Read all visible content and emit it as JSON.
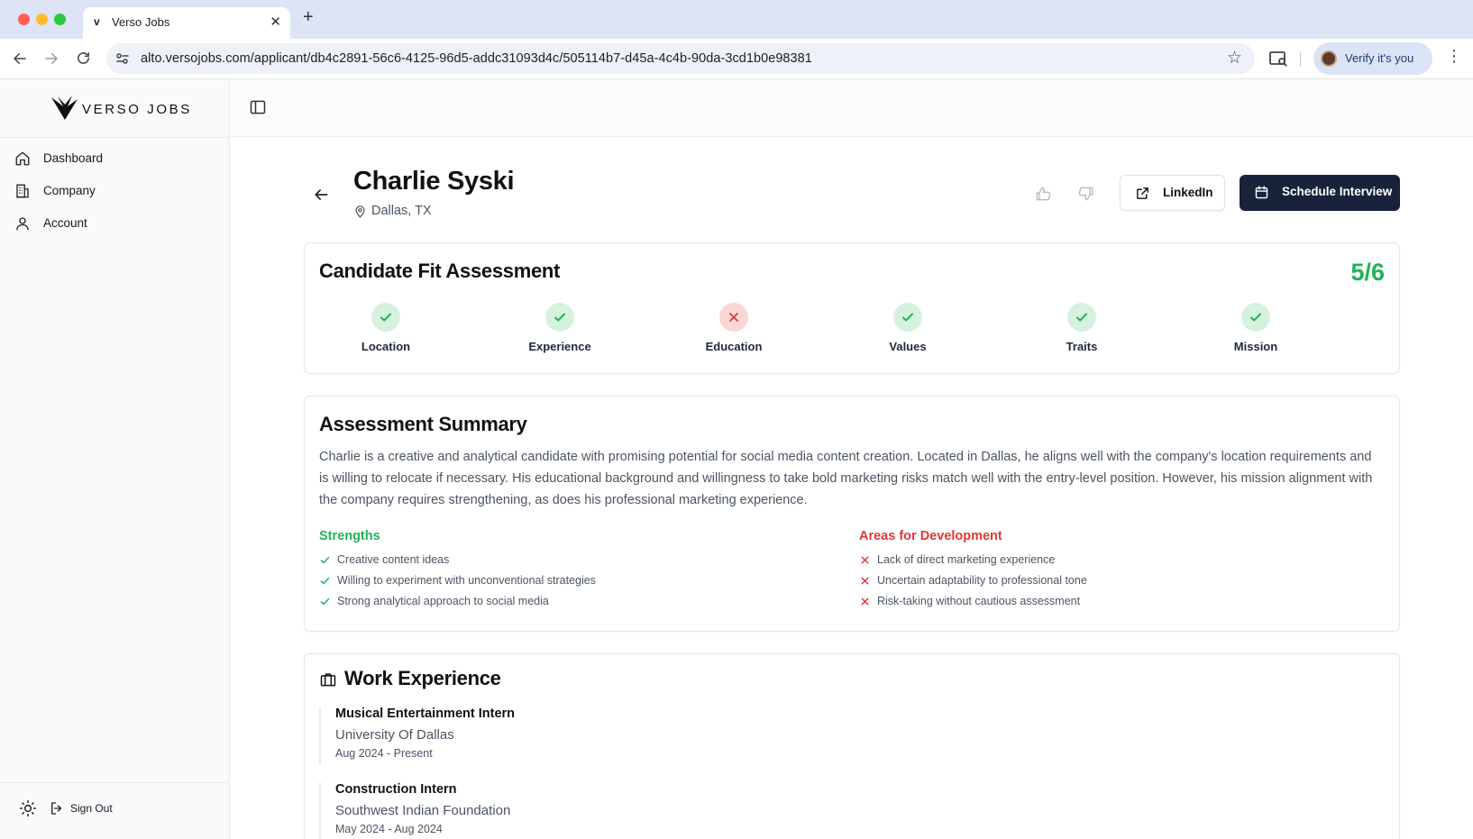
{
  "browser": {
    "tab_title": "Verso Jobs",
    "tab_favicon": "v",
    "url": "alto.versojobs.com/applicant/db4c2891-56c6-4125-96d5-addc31093d4c/505114b7-d45a-4c4b-90da-3cd1b0e98381",
    "verify_label": "Verify it's you"
  },
  "brand": {
    "logo_text": "VERSO JOBS"
  },
  "sidebar": {
    "items": [
      {
        "label": "Dashboard",
        "icon": "home-icon"
      },
      {
        "label": "Company",
        "icon": "building-icon"
      },
      {
        "label": "Account",
        "icon": "user-icon"
      }
    ],
    "sign_out_label": "Sign Out"
  },
  "candidate": {
    "name": "Charlie Syski",
    "location": "Dallas, TX"
  },
  "actions": {
    "linkedin_label": "LinkedIn",
    "schedule_label": "Schedule Interview"
  },
  "fit": {
    "title": "Candidate Fit Assessment",
    "score": "5/6",
    "criteria": [
      {
        "label": "Location",
        "status": "pass"
      },
      {
        "label": "Experience",
        "status": "pass"
      },
      {
        "label": "Education",
        "status": "fail"
      },
      {
        "label": "Values",
        "status": "pass"
      },
      {
        "label": "Traits",
        "status": "pass"
      },
      {
        "label": "Mission",
        "status": "pass"
      }
    ]
  },
  "summary": {
    "title": "Assessment Summary",
    "text": "Charlie is a creative and analytical candidate with promising potential for social media content creation. Located in Dallas, he aligns well with the company's location requirements and is willing to relocate if necessary. His educational background and willingness to take bold marketing risks match well with the entry-level position. However, his mission alignment with the company requires strengthening, as does his professional marketing experience.",
    "strengths_title": "Strengths",
    "strengths": [
      "Creative content ideas",
      "Willing to experiment with unconventional strategies",
      "Strong analytical approach to social media"
    ],
    "development_title": "Areas for Development",
    "development": [
      "Lack of direct marketing experience",
      "Uncertain adaptability to professional tone",
      "Risk-taking without cautious assessment"
    ]
  },
  "work": {
    "title": "Work Experience",
    "jobs": [
      {
        "title": "Musical Entertainment Intern",
        "company": "University Of Dallas",
        "dates": "Aug 2024 - Present"
      },
      {
        "title": "Construction Intern",
        "company": "Southwest Indian Foundation",
        "dates": "May 2024 - Aug 2024"
      }
    ]
  },
  "colors": {
    "accent_green": "#22b35a",
    "accent_red": "#e03838",
    "primary_dark": "#18223a"
  }
}
